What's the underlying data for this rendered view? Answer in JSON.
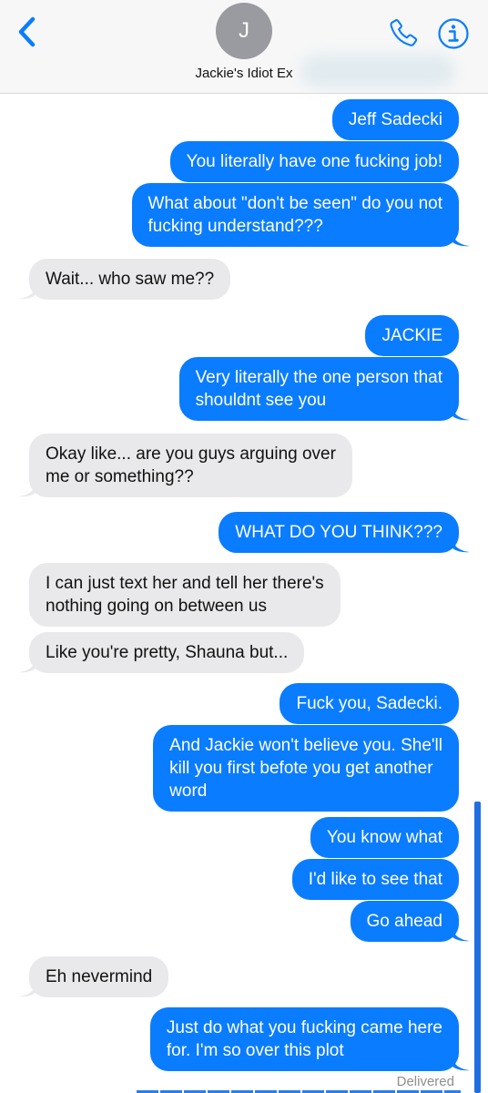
{
  "header": {
    "contact_initial": "J",
    "contact_name": "Jackie's Idiot Ex",
    "back_icon": "chevron-left-icon",
    "phone_icon": "phone-icon",
    "info_icon": "info-icon",
    "accent_color": "#0a7cff"
  },
  "colors": {
    "sent_bubble": "#0a7cff",
    "received_bubble": "#e9e9eb"
  },
  "messages": [
    {
      "dir": "sent",
      "text": "Jeff Sadecki"
    },
    {
      "dir": "sent",
      "text": "You literally have one fucking job!"
    },
    {
      "dir": "sent",
      "text": "What about \"don't be seen\" do you not\nfucking understand???"
    },
    {
      "dir": "received",
      "text": "Wait... who saw me??"
    },
    {
      "dir": "sent",
      "text": "JACKIE"
    },
    {
      "dir": "sent",
      "text": "Very literally the one person that\nshouldnt see you"
    },
    {
      "dir": "received",
      "text": "Okay like... are you guys arguing over\nme or something??"
    },
    {
      "dir": "sent",
      "text": "WHAT DO YOU THINK???"
    },
    {
      "dir": "received",
      "text": "I can just text her and tell her there's\nnothing going on between us"
    },
    {
      "dir": "received",
      "text": "Like you're pretty, Shauna but..."
    },
    {
      "dir": "sent",
      "text": "Fuck you, Sadecki."
    },
    {
      "dir": "sent",
      "text": "And Jackie won't believe you. She'll\nkill you first befote you get another\nword"
    },
    {
      "dir": "sent",
      "text": "You know what"
    },
    {
      "dir": "sent",
      "text": "I'd like to see that"
    },
    {
      "dir": "sent",
      "text": "Go ahead"
    },
    {
      "dir": "received",
      "text": "Eh nevermind"
    },
    {
      "dir": "sent",
      "text": "Just do what you fucking came here\nfor. I'm so over this plot"
    }
  ],
  "status": {
    "delivered": "Delivered"
  }
}
